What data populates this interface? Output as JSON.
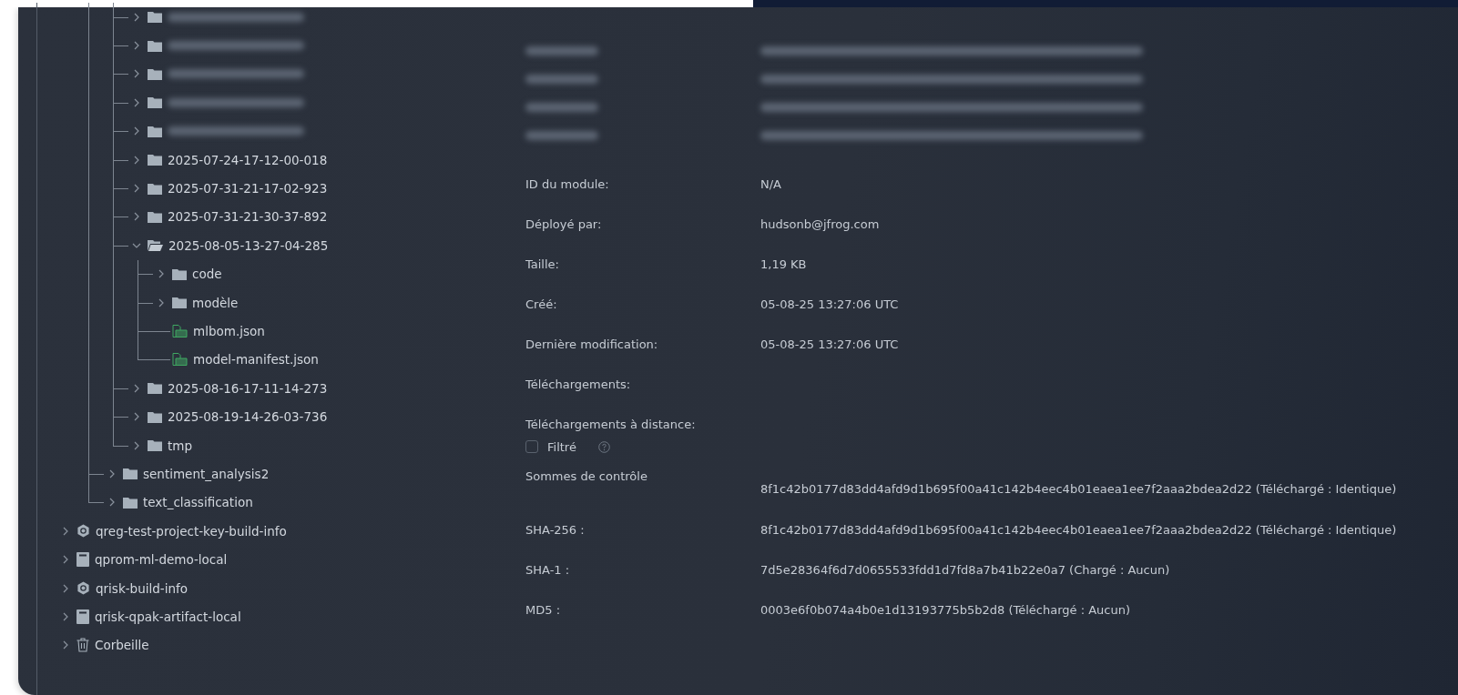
{
  "tree": [
    {
      "children": [
        {
          "children": [
            {
              "kind": "folder",
              "expanded": false,
              "redacted": true
            },
            {
              "kind": "folder",
              "expanded": false,
              "redacted": true
            },
            {
              "kind": "folder",
              "expanded": false,
              "redacted": true
            },
            {
              "kind": "folder",
              "expanded": false,
              "redacted": true
            },
            {
              "kind": "folder",
              "expanded": false,
              "redacted": true
            },
            {
              "kind": "folder",
              "expanded": false,
              "label": "2025-07-24-17-12-00-018"
            },
            {
              "kind": "folder",
              "expanded": false,
              "label": "2025-07-31-21-17-02-923"
            },
            {
              "kind": "folder",
              "expanded": false,
              "label": "2025-07-31-21-30-37-892"
            },
            {
              "kind": "folder-open",
              "expanded": true,
              "label": "2025-08-05-13-27-04-285",
              "children": [
                {
                  "kind": "folder",
                  "expanded": false,
                  "label": "code"
                },
                {
                  "kind": "folder",
                  "expanded": false,
                  "label": "modèle"
                },
                {
                  "kind": "file",
                  "label": "mlbom.json"
                },
                {
                  "kind": "file",
                  "label": "model-manifest.json"
                }
              ]
            },
            {
              "kind": "folder",
              "expanded": false,
              "label": "2025-08-16-17-11-14-273"
            },
            {
              "kind": "folder",
              "expanded": false,
              "label": "2025-08-19-14-26-03-736"
            },
            {
              "kind": "folder",
              "expanded": false,
              "label": "tmp"
            }
          ]
        },
        {
          "kind": "folder",
          "expanded": false,
          "label": "sentiment_analysis2"
        },
        {
          "kind": "folder",
          "expanded": false,
          "label": "text_classification"
        }
      ]
    },
    {
      "kind": "build",
      "expanded": false,
      "label": "qreg-test-project-key-build-info"
    },
    {
      "kind": "repo",
      "expanded": false,
      "label": "qprom-ml-demo-local"
    },
    {
      "kind": "build",
      "expanded": false,
      "label": "qrisk-build-info"
    },
    {
      "kind": "repo",
      "expanded": false,
      "label": "qrisk-qpak-artifact-local"
    },
    {
      "kind": "trash",
      "expanded": false,
      "label": "Corbeille"
    }
  ],
  "details": [
    {
      "kind": "redacted"
    },
    {
      "kind": "redacted"
    },
    {
      "kind": "redacted"
    },
    {
      "kind": "redacted"
    },
    {
      "kind": "field",
      "label": "ID du module:",
      "value": "N/A"
    },
    {
      "kind": "field",
      "label": "Déployé par:",
      "value": "hudsonb@jfrog.com"
    },
    {
      "kind": "field",
      "label": "Taille:",
      "value": "1,19 KB"
    },
    {
      "kind": "field",
      "label": "Créé:",
      "value": "05-08-25 13:27:06 UTC"
    },
    {
      "kind": "field",
      "label": "Dernière modification:",
      "value": "05-08-25 13:27:06 UTC"
    },
    {
      "kind": "field",
      "label": "Téléchargements:"
    },
    {
      "kind": "field",
      "label": "Téléchargements à distance:"
    },
    {
      "kind": "checkbox",
      "label": "Filtré",
      "checked": false
    },
    {
      "kind": "summary",
      "label": "Sommes de contrôle",
      "value": "8f1c42b0177d83dd4afd9d1b695f00a41c142b4eec4b01eaea1ee7f2aaa2bdea2d22 (Téléchargé : Identique)"
    },
    {
      "kind": "field",
      "label": "SHA-256 :",
      "value": "8f1c42b0177d83dd4afd9d1b695f00a41c142b4eec4b01eaea1ee7f2aaa2bdea2d22 (Téléchargé : Identique)"
    },
    {
      "kind": "field",
      "label": "SHA-1 :",
      "value": "7d5e28364f6d7d0655533fdd1d7fd8a7b41b22e0a7 (Chargé : Aucun)"
    },
    {
      "kind": "field",
      "label": "MD5 :",
      "value": "0003e6f0b074a4b0e1d13193775b5b2d8 (Téléchargé : Aucun)"
    }
  ]
}
